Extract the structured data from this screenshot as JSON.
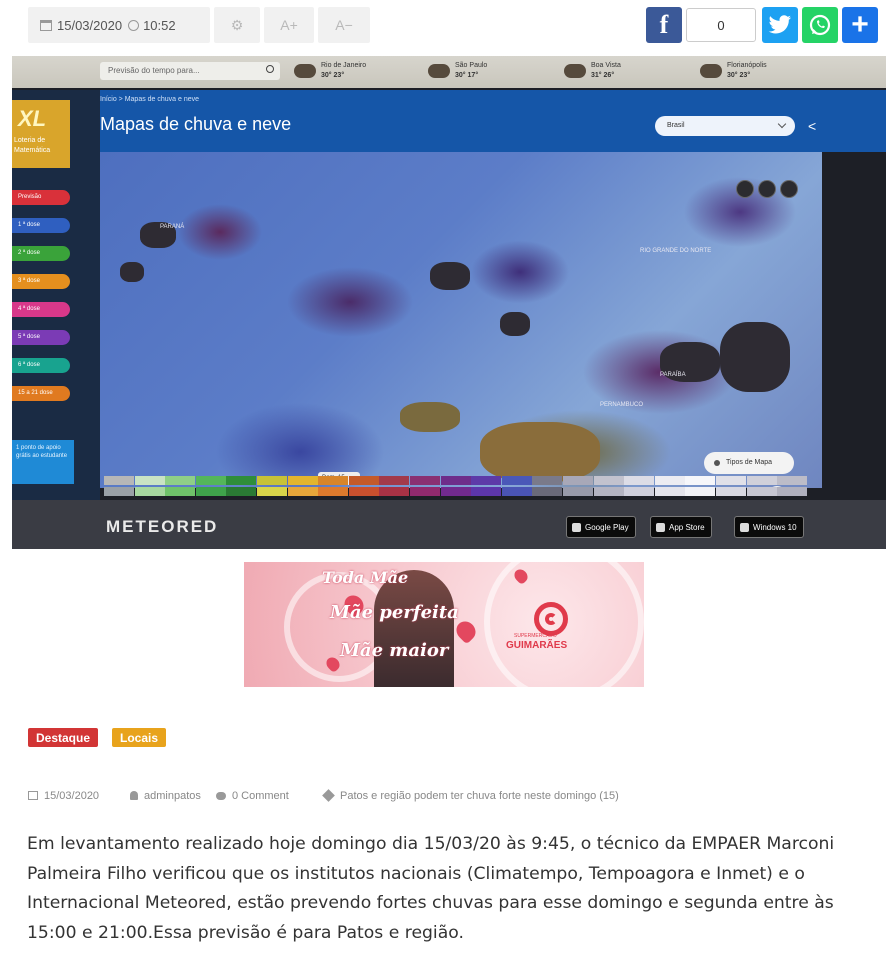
{
  "meta_bar": {
    "date": "15/03/2020",
    "time": "10:52",
    "settings_icon": "gear-icon",
    "font_increase_label": "A+",
    "font_decrease_label": "A−"
  },
  "share": {
    "facebook_label": "f",
    "count": "0",
    "twitter_icon": "twitter-bird-icon",
    "whatsapp_icon": "whatsapp-icon",
    "add_label": "+",
    "colors": {
      "facebook": "#3b5998",
      "twitter": "#1da1f2",
      "whatsapp": "#25d366",
      "add": "#1a73e8"
    }
  },
  "photo": {
    "search_placeholder": "Previsão do tempo para...",
    "cities": [
      {
        "name": "Rio de Janeiro",
        "temps": "30°  23°"
      },
      {
        "name": "São Paulo",
        "temps": "30°  17°"
      },
      {
        "name": "Boa Vista",
        "temps": "31°  26°"
      },
      {
        "name": "Florianópolis",
        "temps": "30°  23°"
      }
    ],
    "breadcrumb": "Início > Mapas de chuva e neve",
    "title": "Mapas de chuva e neve",
    "region_select": "Brasil",
    "logo_text": "XL",
    "logo_caption": "Loteria de Matemática",
    "sidebar_pills": [
      {
        "label": "Previsão",
        "color": "#d9313a"
      },
      {
        "label": "1 ª dose",
        "color": "#2f5fc0"
      },
      {
        "label": "2 ª dose",
        "color": "#3aa33a"
      },
      {
        "label": "3 ª dose",
        "color": "#e58f1e"
      },
      {
        "label": "4 ª dose",
        "color": "#d8388a"
      },
      {
        "label": "5 ª dose",
        "color": "#7b3bb5"
      },
      {
        "label": "6 ª dose",
        "color": "#18a38f"
      },
      {
        "label": "15 a 21 dose",
        "color": "#e07a20"
      }
    ],
    "sidebar_note": "1 ponto de apoio grátis ao estudante",
    "map_labels": [
      "PARANÁ",
      "RIO GRANDE DO NORTE",
      "PERNAMBUCO",
      "PARAÍBA"
    ],
    "map_type_label": "Tipos de Mapa",
    "timeline_date": "Dom, 15 · 15:00",
    "brand": "METEORED",
    "stores": [
      "Google Play",
      "App Store",
      "Windows 10"
    ]
  },
  "banner": {
    "script_line_1": "Toda Mãe",
    "script_line_2": "Mãe perfeita",
    "script_line_3": "Mãe maior",
    "brand_small": "SUPERMERCADO",
    "brand": "GUIMARÃES"
  },
  "tags": [
    "Destaque",
    "Locais"
  ],
  "post": {
    "date": "15/03/2020",
    "author": "adminpatos",
    "comments": "0 Comment",
    "topic": "Patos e região podem ter chuva forte neste domingo (15)"
  },
  "article": {
    "paragraph": "Em levantamento realizado hoje domingo dia 15/03/20 às 9:45, o técnico da EMPAER Marconi Palmeira Filho verificou que os institutos nacionais (Climatempo, Tempoagora e Inmet) e o Internacional Meteored, estão prevendo fortes chuvas para esse domingo e segunda entre às 15:00 e 21:00.Essa previsão é para Patos e região."
  }
}
